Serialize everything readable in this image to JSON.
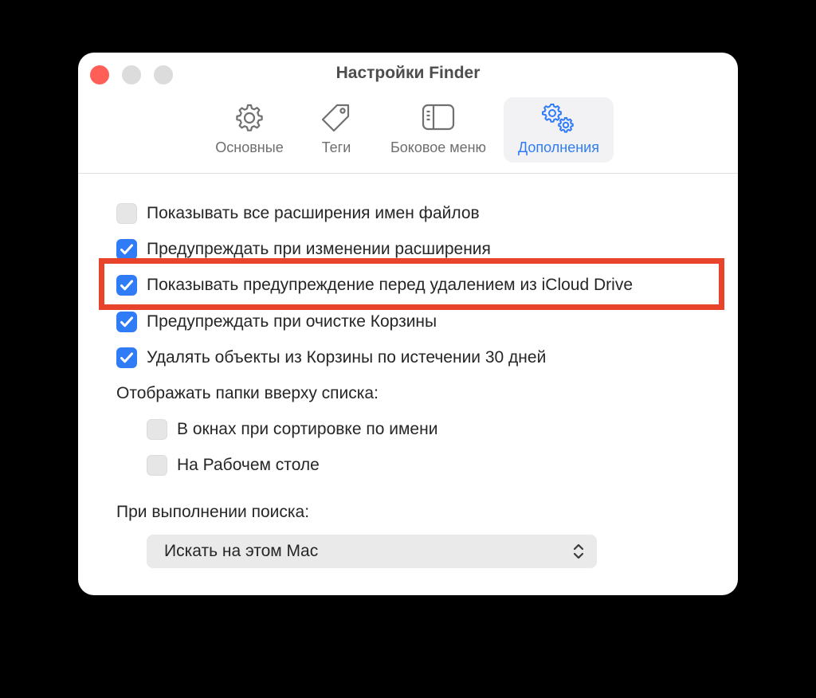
{
  "window": {
    "title": "Настройки Finder"
  },
  "tabs": [
    {
      "label": "Основные",
      "icon": "gear-icon",
      "active": false
    },
    {
      "label": "Теги",
      "icon": "tag-icon",
      "active": false
    },
    {
      "label": "Боковое меню",
      "icon": "sidebar-icon",
      "active": false
    },
    {
      "label": "Дополнения",
      "icon": "gears-icon",
      "active": true
    }
  ],
  "options": [
    {
      "label": "Показывать все расширения имен файлов",
      "checked": false
    },
    {
      "label": "Предупреждать при изменении расширения",
      "checked": true
    },
    {
      "label": "Показывать предупреждение перед удалением из iCloud Drive",
      "checked": true
    },
    {
      "label": "Предупреждать при очистке Корзины",
      "checked": true
    },
    {
      "label": "Удалять объекты из Корзины по истечении 30 дней",
      "checked": true
    }
  ],
  "folders_on_top": {
    "heading": "Отображать папки вверху списка:",
    "options": [
      {
        "label": "В окнах при сортировке по имени",
        "checked": false
      },
      {
        "label": "На Рабочем столе",
        "checked": false
      }
    ]
  },
  "search": {
    "heading": "При выполнении поиска:",
    "selected": "Искать на этом Mac"
  },
  "colors": {
    "accent": "#2f7cf6",
    "highlight": "#e8432b",
    "close": "#ff5f57"
  }
}
